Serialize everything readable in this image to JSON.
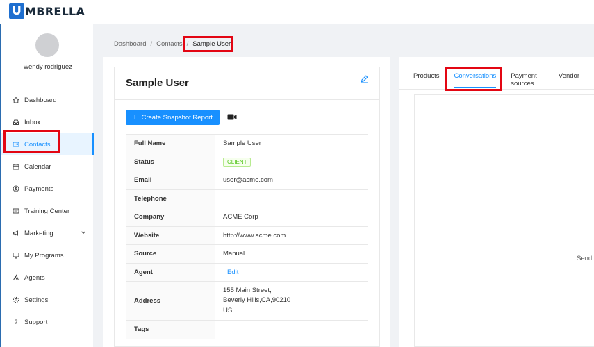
{
  "brand": {
    "logo_letter": "U",
    "logo_text": "MBRELLA"
  },
  "user": {
    "name": "wendy rodriguez"
  },
  "sidebar": {
    "items": [
      {
        "label": "Dashboard",
        "icon": "home-icon"
      },
      {
        "label": "Inbox",
        "icon": "inbox-icon"
      },
      {
        "label": "Contacts",
        "icon": "contacts-icon",
        "active": true
      },
      {
        "label": "Calendar",
        "icon": "calendar-icon"
      },
      {
        "label": "Payments",
        "icon": "dollar-icon"
      },
      {
        "label": "Training Center",
        "icon": "training-icon"
      },
      {
        "label": "Marketing",
        "icon": "megaphone-icon",
        "has_submenu": true
      },
      {
        "label": "My Programs",
        "icon": "monitor-icon"
      },
      {
        "label": "Agents",
        "icon": "agents-icon"
      },
      {
        "label": "Settings",
        "icon": "gear-icon"
      },
      {
        "label": "Support",
        "icon": "question-icon"
      }
    ]
  },
  "breadcrumb": {
    "items": [
      "Dashboard",
      "Contacts"
    ],
    "current": "Sample User"
  },
  "contact": {
    "title": "Sample User",
    "snapshot_button": "Create Snapshot Report",
    "fields": {
      "full_name": {
        "label": "Full Name",
        "value": "Sample User"
      },
      "status": {
        "label": "Status",
        "value": "CLIENT"
      },
      "email": {
        "label": "Email",
        "value": "user@acme.com"
      },
      "telephone": {
        "label": "Telephone",
        "value": ""
      },
      "company": {
        "label": "Company",
        "value": "ACME Corp"
      },
      "website": {
        "label": "Website",
        "value": "http://www.acme.com"
      },
      "source": {
        "label": "Source",
        "value": "Manual"
      },
      "agent": {
        "label": "Agent",
        "value": "Edit"
      },
      "address": {
        "label": "Address",
        "line1": "155 Main Street,",
        "line2": "Beverly Hills,CA,90210",
        "line3": "US"
      },
      "tags": {
        "label": "Tags",
        "value": ""
      }
    }
  },
  "right_panel": {
    "tabs": [
      "Products",
      "Conversations",
      "Payment sources",
      "Vendor"
    ],
    "active_tab": "Conversations",
    "send_text": "Send a"
  },
  "colors": {
    "accent": "#1890ff",
    "highlight": "#e30613",
    "brand": "#1e6fd0",
    "status_green": "#52c41a"
  }
}
